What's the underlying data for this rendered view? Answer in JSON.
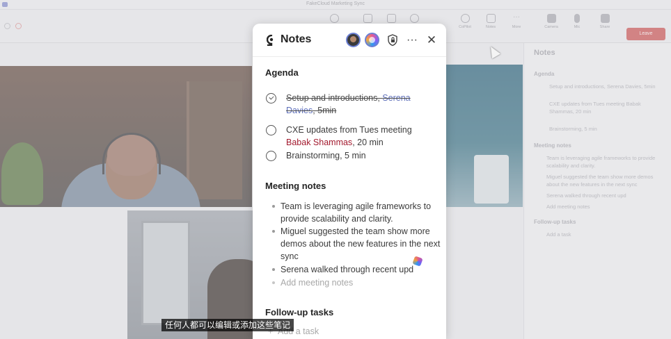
{
  "window": {
    "title": "FakeCloud Marketing Sync"
  },
  "toolbar": {
    "buttons": [
      {
        "label": "",
        "icon": "emoji-icon"
      },
      {
        "label": "",
        "icon": "hand-icon"
      },
      {
        "label": "",
        "icon": "breakout-icon"
      },
      {
        "label": "",
        "icon": "chat-icon"
      },
      {
        "label": "CoPilot",
        "icon": "copilot-icon"
      },
      {
        "label": "Notes",
        "icon": "notes-icon"
      },
      {
        "label": "More",
        "icon": "more-icon"
      },
      {
        "label": "Camera",
        "icon": "camera-icon"
      },
      {
        "label": "Mic",
        "icon": "mic-icon"
      },
      {
        "label": "Share",
        "icon": "share-icon"
      }
    ],
    "leave_label": "Leave"
  },
  "notes": {
    "title": "Notes",
    "header_icons": [
      "avatar-user",
      "avatar-copilot",
      "shield-lock-icon",
      "more-icon",
      "close-icon"
    ],
    "agenda": {
      "heading": "Agenda",
      "items": [
        {
          "text_before": "Setup and introductions, ",
          "person": "Serena Davies",
          "text_after": ", 5min",
          "done": true
        },
        {
          "text_before": "CXE updates from Tues meeting ",
          "person": "Babak Shammas",
          "text_after": ", 20 min",
          "done": false
        },
        {
          "text_before": "Brainstorming, 5 min",
          "person": "",
          "text_after": "",
          "done": false
        }
      ]
    },
    "meeting_notes": {
      "heading": "Meeting notes",
      "items": [
        "Team is leveraging agile frameworks to provide scalability and clarity.",
        "Miguel suggested the team show more demos about the new features in the next sync",
        "Serena walked through recent upd"
      ],
      "placeholder": "Add meeting notes"
    },
    "followup": {
      "heading": "Follow-up tasks",
      "placeholder": "Add a task"
    }
  },
  "side_panel": {
    "title": "Notes",
    "agenda_heading": "Agenda",
    "agenda_items": [
      "Setup and introductions, Serena Davies, 5min",
      "CXE updates from Tues meeting Babak Shammas, 20 min",
      "Brainstorming, 5 min"
    ],
    "notes_heading": "Meeting notes",
    "notes_items": [
      "Team is leveraging agile frameworks to provide scalability and clarity.",
      "Miguel suggested the team show more demos about the new features in the next sync",
      "Serena walked through recent upd",
      "Add meeting notes"
    ],
    "followup_heading": "Follow-up tasks",
    "followup_placeholder": "Add a task"
  },
  "subtitle": "任何人都可以编辑或添加这些笔记",
  "colors": {
    "person_link": "#5e6fba",
    "person_mention": "#a31a2e",
    "leave": "#c8494a",
    "accent": "#6b7fd3"
  }
}
